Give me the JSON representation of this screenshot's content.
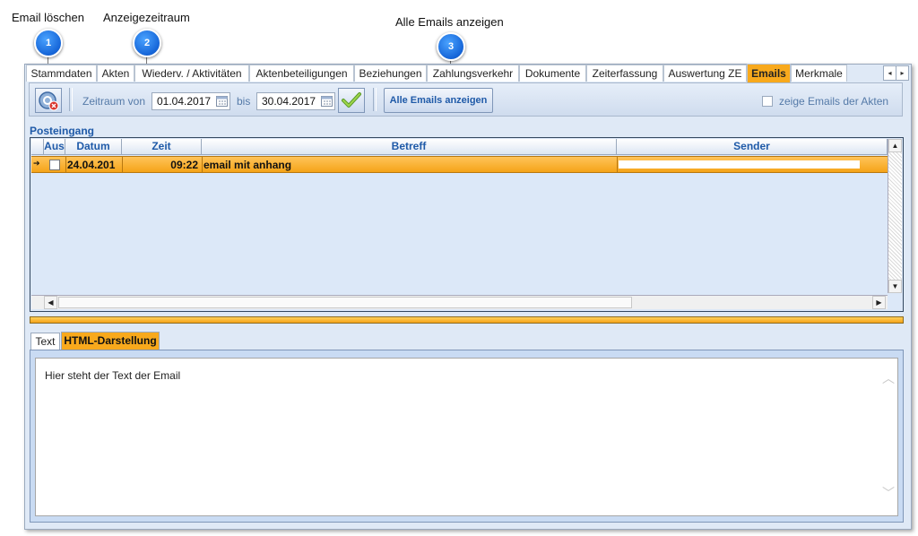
{
  "callouts": [
    {
      "number": "1",
      "label": "Email löschen"
    },
    {
      "number": "2",
      "label": "Anzeigezeitraum"
    },
    {
      "number": "3",
      "label": "Alle Emails anzeigen"
    }
  ],
  "tabs": [
    {
      "label": "Stammdaten"
    },
    {
      "label": "Akten"
    },
    {
      "label": "Wiederv. / Aktivitäten"
    },
    {
      "label": "Aktenbeteiligungen"
    },
    {
      "label": "Beziehungen"
    },
    {
      "label": "Zahlungsverkehr"
    },
    {
      "label": "Dokumente"
    },
    {
      "label": "Zeiterfassung"
    },
    {
      "label": "Auswertung ZE"
    },
    {
      "label": "Emails",
      "active": true
    },
    {
      "label": "Merkmale"
    }
  ],
  "toolbar": {
    "zeitraum_label": "Zeitraum von",
    "date_from": "01.04.2017",
    "bis_label": "bis",
    "date_to": "30.04.2017",
    "show_all_button": "Alle Emails anzeigen",
    "checkbox_label": "zeige Emails der Akten"
  },
  "inbox": {
    "title": "Posteingang",
    "columns": [
      "Aus",
      "Datum",
      "Zeit",
      "Betreff",
      "Sender"
    ],
    "rows": [
      {
        "aus": false,
        "datum": "24.04.201",
        "zeit": "09:22",
        "betreff": "email mit anhang",
        "sender": ""
      }
    ]
  },
  "preview": {
    "tabs": [
      {
        "label": "Text"
      },
      {
        "label": "HTML-Darstellung",
        "active": true
      }
    ],
    "body": "Hier steht der Text der Email"
  },
  "colors": {
    "accent_orange": "#f8a91c",
    "header_blue": "#1f5aa8",
    "panel_blue": "#dfe9f6"
  }
}
